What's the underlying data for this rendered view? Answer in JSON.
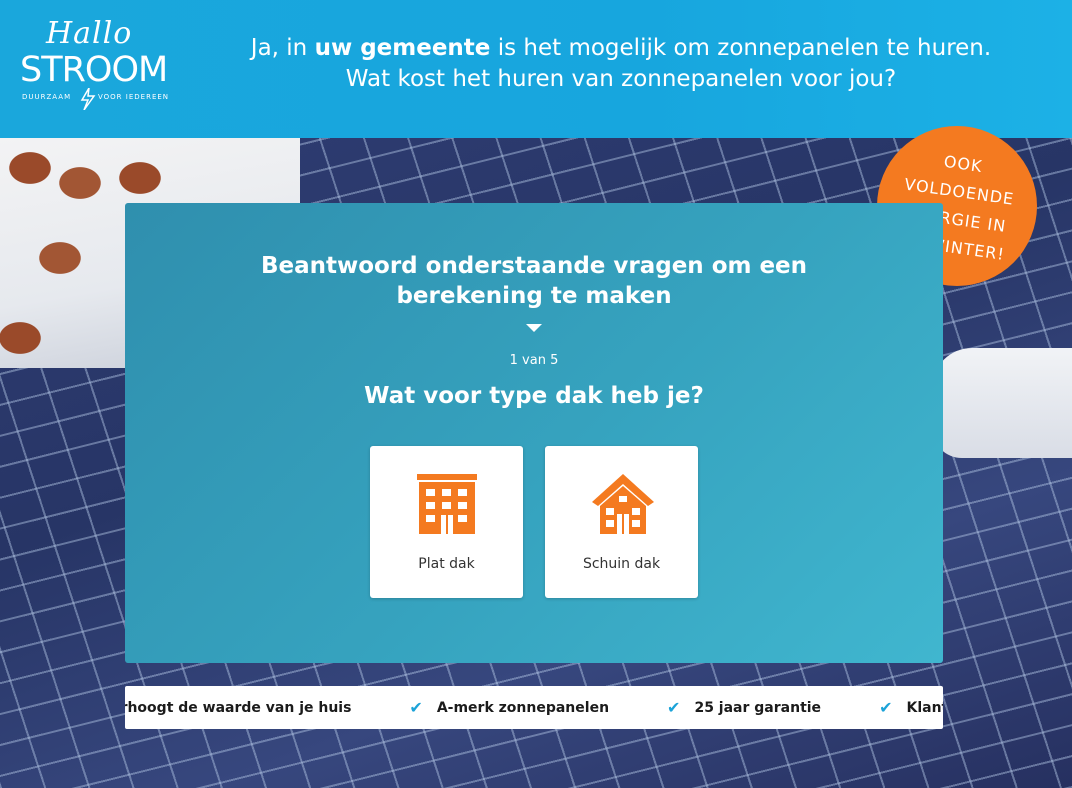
{
  "header": {
    "logo": {
      "hallo": "Hallo",
      "stroom": "STROOM",
      "tagline_left": "DUURZAAM",
      "tagline_right": "VOOR IEDEREEN"
    },
    "headline_line1_before": "Ja, in ",
    "headline_line1_bold": "uw gemeente",
    "headline_line1_after": " is het mogelijk om zonnepanelen te huren.",
    "headline_line2": "Wat kost het huren van zonnepanelen voor jou?"
  },
  "badge": {
    "lines": [
      "OOK",
      "VOLDOENDE",
      "ENERGIE IN",
      "DE WINTER!"
    ],
    "color": "#f47a20"
  },
  "quiz": {
    "title_line1": "Beantwoord onderstaande vragen om een",
    "title_line2": "berekening te maken",
    "step": "1 van 5",
    "question": "Wat voor type dak heb je?",
    "options": [
      {
        "label": "Plat dak",
        "icon": "flat-roof-building-icon"
      },
      {
        "label": "Schuin dak",
        "icon": "sloped-roof-house-icon"
      }
    ],
    "icon_color": "#f47a20"
  },
  "benefits": [
    {
      "text": "Verhoogt de waarde van je huis",
      "icon": "check-icon"
    },
    {
      "text": "A-merk zonnepanelen",
      "icon": "check-icon"
    },
    {
      "text": "25 jaar garantie",
      "icon": "check-icon"
    },
    {
      "text": "Klantenbeoordeling",
      "icon": "check-icon"
    }
  ],
  "colors": {
    "header_blue": "#1aa7dc",
    "card_teal": "#36a3bf",
    "check_blue": "#1ca3d8"
  }
}
